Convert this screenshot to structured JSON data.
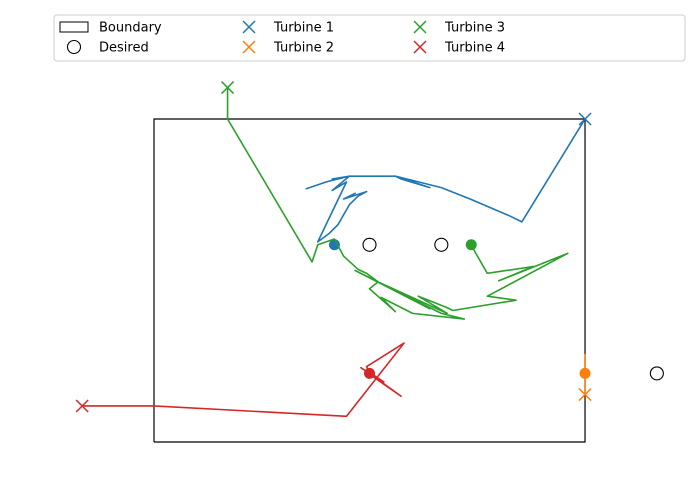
{
  "chart_data": {
    "type": "line",
    "title": "",
    "xlabel": "",
    "ylabel": "",
    "xlim": [
      0,
      1000
    ],
    "ylim": [
      0,
      700
    ],
    "grid": false,
    "axes_visible": false,
    "legend": {
      "placement": "top",
      "columns": 4,
      "entries": [
        {
          "label": "Boundary",
          "marker": "rect"
        },
        {
          "label": "Desired",
          "marker": "circle"
        },
        {
          "label": "Turbine 1",
          "marker": "x",
          "color": "#1f77b4"
        },
        {
          "label": "Turbine 2",
          "marker": "x",
          "color": "#ff7f0e"
        },
        {
          "label": "Turbine 3",
          "marker": "x",
          "color": "#2ca02c"
        },
        {
          "label": "Turbine 4",
          "marker": "x",
          "color": "#d62728"
        }
      ]
    },
    "boundary": {
      "x": [
        100,
        850,
        850,
        100,
        100
      ],
      "y": [
        125,
        125,
        690,
        690,
        125
      ]
    },
    "desired": [
      {
        "x": 475,
        "y": 470
      },
      {
        "x": 600,
        "y": 470
      },
      {
        "x": 975,
        "y": 245
      }
    ],
    "series": [
      {
        "name": "Turbine 1",
        "color": "#1f77b4",
        "start": {
          "x": 850,
          "y": 690
        },
        "end": {
          "x": 414,
          "y": 470
        },
        "path": [
          [
            850,
            690
          ],
          [
            740,
            510
          ],
          [
            720,
            520
          ],
          [
            650,
            550
          ],
          [
            600,
            570
          ],
          [
            560,
            580
          ],
          [
            540,
            585
          ],
          [
            550,
            580
          ],
          [
            580,
            570
          ],
          [
            530,
            585
          ],
          [
            520,
            590
          ],
          [
            540,
            585
          ],
          [
            520,
            590
          ],
          [
            480,
            590
          ],
          [
            440,
            590
          ],
          [
            410,
            585
          ],
          [
            440,
            590
          ],
          [
            400,
            580
          ],
          [
            365,
            568
          ],
          [
            400,
            580
          ],
          [
            440,
            590
          ],
          [
            410,
            565
          ],
          [
            435,
            580
          ],
          [
            385,
            475
          ],
          [
            405,
            490
          ],
          [
            420,
            505
          ],
          [
            440,
            540
          ],
          [
            455,
            555
          ],
          [
            470,
            563
          ],
          [
            430,
            550
          ],
          [
            450,
            560
          ],
          [
            440,
            555
          ]
        ]
      },
      {
        "name": "Turbine 2",
        "color": "#ff7f0e",
        "start": {
          "x": 850,
          "y": 208
        },
        "end": {
          "x": 850,
          "y": 245
        },
        "path": [
          [
            850,
            208
          ],
          [
            850,
            220
          ],
          [
            850,
            235
          ],
          [
            850,
            245
          ],
          [
            850,
            255
          ],
          [
            850,
            265
          ],
          [
            850,
            278
          ],
          [
            850,
            248
          ],
          [
            850,
            245
          ]
        ]
      },
      {
        "name": "Turbine 3",
        "color": "#2ca02c",
        "start": {
          "x": 228,
          "y": 745
        },
        "end": {
          "x": 652,
          "y": 470
        },
        "path": [
          [
            228,
            745
          ],
          [
            228,
            690
          ],
          [
            375,
            440
          ],
          [
            385,
            470
          ],
          [
            414,
            480
          ],
          [
            430,
            450
          ],
          [
            455,
            427
          ],
          [
            470,
            420
          ],
          [
            490,
            405
          ],
          [
            475,
            393
          ],
          [
            520,
            353
          ],
          [
            495,
            378
          ],
          [
            550,
            350
          ],
          [
            640,
            340
          ],
          [
            600,
            350
          ],
          [
            450,
            425
          ],
          [
            580,
            358
          ],
          [
            490,
            405
          ],
          [
            610,
            350
          ],
          [
            560,
            380
          ],
          [
            610,
            360
          ],
          [
            620,
            355
          ],
          [
            730,
            373
          ],
          [
            680,
            380
          ],
          [
            820,
            455
          ],
          [
            700,
            407
          ],
          [
            760,
            432
          ],
          [
            680,
            420
          ],
          [
            660,
            455
          ],
          [
            652,
            470
          ]
        ]
      },
      {
        "name": "Turbine 4",
        "color": "#d62728",
        "start": {
          "x": -25,
          "y": 188
        },
        "end": {
          "x": 475,
          "y": 245
        },
        "path": [
          [
            -25,
            188
          ],
          [
            100,
            188
          ],
          [
            435,
            170
          ],
          [
            535,
            298
          ],
          [
            470,
            257
          ],
          [
            475,
            245
          ],
          [
            530,
            205
          ],
          [
            480,
            240
          ],
          [
            470,
            250
          ],
          [
            500,
            230
          ],
          [
            475,
            245
          ],
          [
            460,
            255
          ],
          [
            475,
            245
          ]
        ]
      }
    ]
  }
}
